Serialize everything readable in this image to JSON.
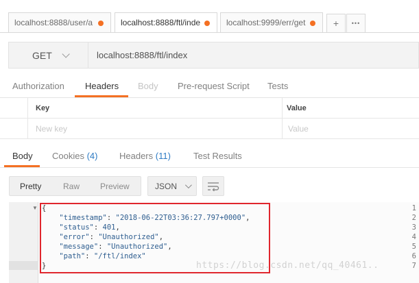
{
  "tabs": [
    {
      "label": "localhost:8888/user/a",
      "unsaved": true
    },
    {
      "label": "localhost:8888/ftl/inde",
      "unsaved": true,
      "active": true
    },
    {
      "label": "localhost:9999/err/get",
      "unsaved": true
    }
  ],
  "tab_actions": {
    "add": "+",
    "more": "•••"
  },
  "request": {
    "method": "GET",
    "url": "localhost:8888/ftl/index"
  },
  "request_tabs": [
    "Authorization",
    "Headers",
    "Body",
    "Pre-request Script",
    "Tests"
  ],
  "headers_table": {
    "key_header": "Key",
    "value_header": "Value",
    "key_placeholder": "New key",
    "value_placeholder": "Value"
  },
  "response_tabs": {
    "body": "Body",
    "cookies": "Cookies",
    "cookies_count": "(4)",
    "headers": "Headers",
    "headers_count": "(11)",
    "test_results": "Test Results"
  },
  "view_modes": [
    "Pretty",
    "Raw",
    "Preview"
  ],
  "format": "JSON",
  "response_lines": [
    {
      "n": "1",
      "text": "{"
    },
    {
      "n": "2",
      "key": "\"timestamp\"",
      "value": "\"2018-06-22T03:36:27.797+0000\"",
      "comma": ","
    },
    {
      "n": "3",
      "key": "\"status\"",
      "value": "401",
      "comma": ","
    },
    {
      "n": "4",
      "key": "\"error\"",
      "value": "\"Unauthorized\"",
      "comma": ","
    },
    {
      "n": "5",
      "key": "\"message\"",
      "value": "\"Unauthorized\"",
      "comma": ","
    },
    {
      "n": "6",
      "key": "\"path\"",
      "value": "\"/ftl/index\"",
      "comma": ""
    },
    {
      "n": "7",
      "text": "}"
    }
  ],
  "watermark": "https://blog.csdn.net/qq_40461..",
  "colors": {
    "accent": "#f47023",
    "highlight_border": "#e0262d",
    "count": "#2e7bc4"
  }
}
